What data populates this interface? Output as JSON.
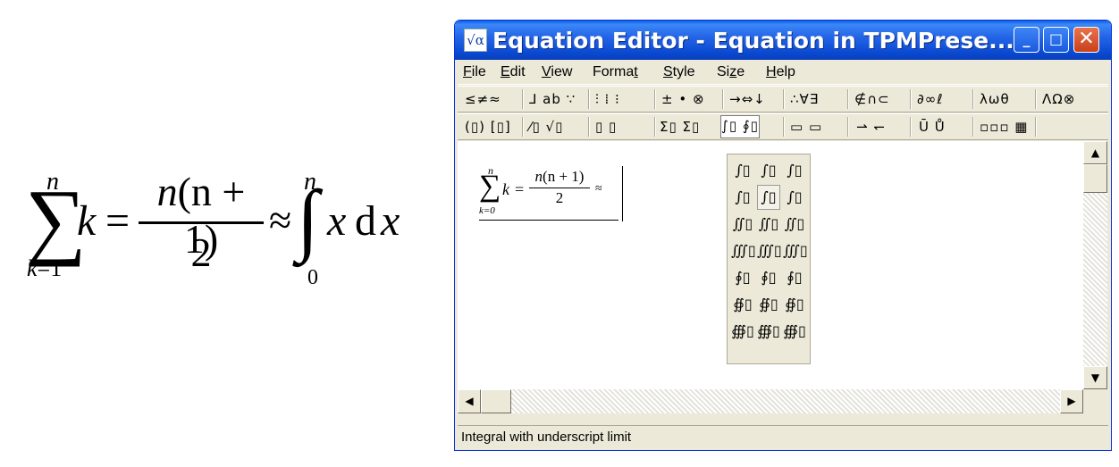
{
  "formula_large": {
    "sum_symbol": "∑",
    "sum_upper": "n",
    "sum_lower_var": "k",
    "sum_lower_rest": "=1",
    "term": "k",
    "equals": "=",
    "numerator_n": "n",
    "numerator_rest": "(n + 1)",
    "denominator": "2",
    "approx": "≈",
    "integral_symbol": "∫",
    "integral_upper": "n",
    "integral_lower": "0",
    "integrand_x": "x",
    "differential_d": "d",
    "differential_x": "x"
  },
  "window": {
    "title": "Equation Editor - Equation in TPMPrese...",
    "app_icon": "√α",
    "minimize_glyph": "_",
    "maximize_glyph": "□",
    "close_glyph": "✕"
  },
  "menu": [
    {
      "u": "F",
      "rest": "ile"
    },
    {
      "u": "E",
      "rest": "dit"
    },
    {
      "u": "V",
      "rest": "iew"
    },
    {
      "pre": "Forma",
      "u": "t",
      "rest": ""
    },
    {
      "u": "S",
      "rest": "tyle"
    },
    {
      "pre": "Si",
      "u": "z",
      "rest": "e"
    },
    {
      "u": "H",
      "rest": "elp"
    }
  ],
  "toolbar_row1": [
    "≤≠≈",
    "⅃ ab ∵",
    "⫶ ⁞ ⁝",
    "± • ⊗",
    "→⇔↓",
    "∴∀∃",
    "∉∩⊂",
    "∂∞ℓ",
    "λωθ",
    "ΛΩ⊗"
  ],
  "toolbar_row2": [
    "(▯) [▯]",
    "⁄▯ √▯",
    "▯ ▯",
    "Σ▯ Σ▯",
    "∫▯ ∮▯",
    "▭ ▭",
    "⇀ ↽",
    "Ū Ů",
    "▫▫▫ ▦"
  ],
  "equation_small": {
    "sum_symbol": "∑",
    "upper": "n",
    "lower": "k=0",
    "term": "k",
    "equals": "=",
    "numerator_n": "n",
    "numerator_rest": "(n + 1)",
    "denominator": "2",
    "approx": "≈"
  },
  "integral_palette": [
    [
      "∫▯",
      "∫▯",
      "∫▯"
    ],
    [
      "∫▯",
      "∫▯",
      "∫▯"
    ],
    [
      "∬▯",
      "∬▯",
      "∬▯"
    ],
    [
      "∭▯",
      "∭▯",
      "∭▯"
    ],
    [
      "∮▯",
      "∮▯",
      "∮▯"
    ],
    [
      "∯▯",
      "∯▯",
      "∯▯"
    ],
    [
      "∰▯",
      "∰▯",
      "∰▯"
    ]
  ],
  "scroll": {
    "up": "▲",
    "down": "▼",
    "left": "◀",
    "right": "▶"
  },
  "status": "Integral with underscript limit"
}
